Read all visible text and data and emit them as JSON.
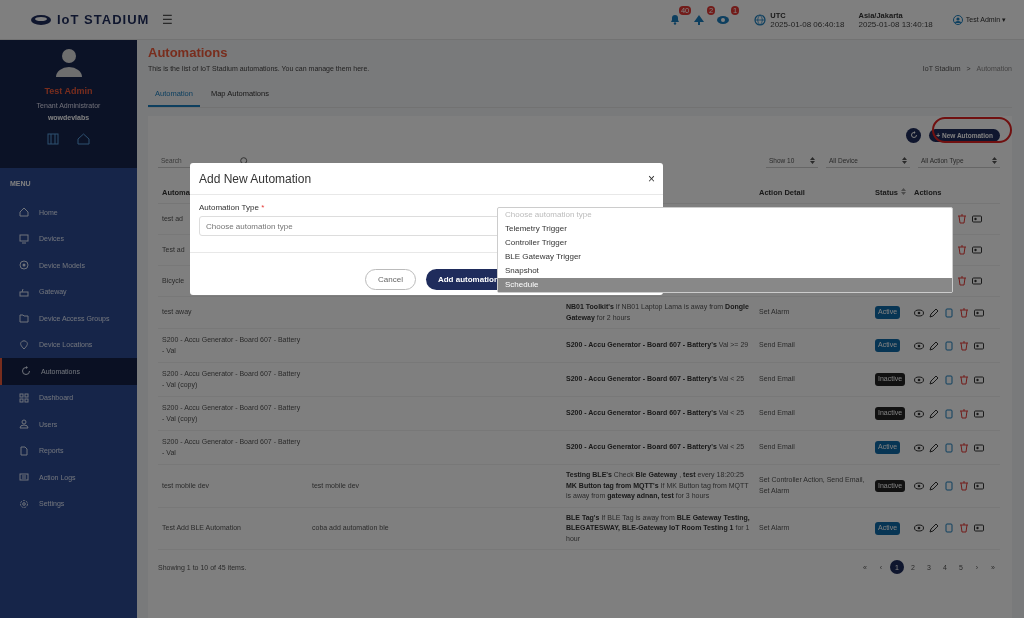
{
  "header": {
    "logo": "IoT STADIUM",
    "menu_glyph": "☰",
    "notifications": [
      {
        "count": "40"
      },
      {
        "count": "2"
      },
      {
        "count": "1"
      }
    ],
    "clocks": [
      {
        "zone": "UTC",
        "time": "2025-01-08 06:40:18"
      },
      {
        "zone": "Asia/Jakarta",
        "time": "2025-01-08 13:40:18"
      }
    ],
    "user": "Test Admin",
    "user_caret": "▾"
  },
  "sidebar": {
    "profile": {
      "name": "Test Admin",
      "role": "Tenant Administrator",
      "tenant": "wowdevlabs"
    },
    "menu_title": "MENU",
    "items": [
      {
        "label": "Home",
        "selected": false
      },
      {
        "label": "Devices",
        "selected": false
      },
      {
        "label": "Device Models",
        "selected": false
      },
      {
        "label": "Gateway",
        "selected": false
      },
      {
        "label": "Device Access Groups",
        "selected": false
      },
      {
        "label": "Device Locations",
        "selected": false
      },
      {
        "label": "Automations",
        "selected": true
      },
      {
        "label": "Dashboard",
        "selected": false
      },
      {
        "label": "Users",
        "selected": false
      },
      {
        "label": "Reports",
        "selected": false
      },
      {
        "label": "Action Logs",
        "selected": false
      },
      {
        "label": "Settings",
        "selected": false
      }
    ]
  },
  "page": {
    "title": "Automations",
    "description": "This is the list of IoT Stadium automations. You can manage them here.",
    "breadcrumb": [
      "IoT Stadium",
      "Automation"
    ],
    "breadcrumb_separator": ">",
    "tabs": [
      {
        "label": "Automation",
        "selected": true
      },
      {
        "label": "Map Automations",
        "selected": false
      }
    ]
  },
  "toolbar": {
    "new_button": "+ New Automation",
    "new_button_highlighted": true,
    "search_placeholder": "Search",
    "filters": [
      "Show 10",
      "All Device",
      "All Action Type"
    ]
  },
  "table": {
    "columns": [
      "Automa",
      "Action Detail",
      "Status",
      "Actions"
    ],
    "rows": [
      {
        "partial": true,
        "name": "test ad"
      },
      {
        "partial": true,
        "name": "Test ad"
      },
      {
        "partial": true,
        "name": "Bicycle"
      },
      {
        "partial": false,
        "name": "test away",
        "description": "",
        "trigger": "**NB01 Toolkit's** If NB01 Laptop Lama is away from **Dongle Gateway** for 2 hours",
        "action": "Set Alarm",
        "status": "Active",
        "active": true
      },
      {
        "partial": false,
        "name": "S200 - Accu Generator - Board 607 - Battery - Val",
        "description": "",
        "trigger": "**S200 - Accu Generator - Board 607 - Battery's** Val >= 29",
        "action": "Send Email",
        "status": "Active",
        "active": true
      },
      {
        "partial": false,
        "name": "S200 - Accu Generator - Board 607 - Battery - Val (copy)",
        "description": "",
        "trigger": "**S200 - Accu Generator - Board 607 - Battery's** Val < 25",
        "action": "Send Email",
        "status": "Inactive",
        "active": false
      },
      {
        "partial": false,
        "name": "S200 - Accu Generator - Board 607 - Battery - Val (copy)",
        "description": "",
        "trigger": "**S200 - Accu Generator - Board 607 - Battery's** Val < 25",
        "action": "Send Email",
        "status": "Inactive",
        "active": false
      },
      {
        "partial": false,
        "name": "S200 - Accu Generator - Board 607 - Battery - Val",
        "description": "",
        "trigger": "**S200 - Accu Generator - Board 607 - Battery's** Val < 25",
        "action": "Send Email",
        "status": "Active",
        "active": true
      },
      {
        "partial": false,
        "name": "test mobile dev",
        "description": "test mobile dev",
        "trigger": "**Testing BLE's** Check **Ble Gateway** , **test** every 18:20:25 **MK Button tag from MQTT's** If MK Button tag from MQTT is away from **gateway adnan, test** for 3 hours",
        "action": "Set Controller Action, Send Email, Set Alarm",
        "status": "Inactive",
        "active": false
      },
      {
        "partial": false,
        "name": "Test Add BLE Automation",
        "description": "coba add automation ble",
        "trigger": "**BLE Tag's** If BLE Tag is away from **BLE Gateway Testing, BLEGATESWAY, BLE-Gateway IoT Room Testing 1** for 1 hour",
        "action": "Set Alarm",
        "status": "Active",
        "active": true
      }
    ],
    "footer": "Showing 1 to 10 of 45 items.",
    "pagination": [
      {
        "label": "«",
        "selected": false
      },
      {
        "label": "‹",
        "selected": false
      },
      {
        "label": "1",
        "selected": true
      },
      {
        "label": "2",
        "selected": false
      },
      {
        "label": "3",
        "selected": false
      },
      {
        "label": "4",
        "selected": false
      },
      {
        "label": "5",
        "selected": false
      },
      {
        "label": "›",
        "selected": false
      },
      {
        "label": "»",
        "selected": false
      }
    ]
  },
  "modal": {
    "title": "Add New Automation",
    "close": "×",
    "field_label": "Automation Type",
    "required_mark": "*",
    "placeholder": "Choose automation type",
    "buttons": [
      {
        "label": "Cancel",
        "kind": "secondary"
      },
      {
        "label": "Add automation",
        "kind": "primary"
      }
    ],
    "dropdown": [
      {
        "label": "Choose automation type",
        "disabled": true,
        "selected": false
      },
      {
        "label": "Telemetry Trigger",
        "disabled": false,
        "selected": false
      },
      {
        "label": "Controller Trigger",
        "disabled": false,
        "selected": false
      },
      {
        "label": "BLE Gateway Trigger",
        "disabled": false,
        "selected": false
      },
      {
        "label": "Snapshot",
        "disabled": false,
        "selected": false
      },
      {
        "label": "Schedule",
        "disabled": false,
        "selected": true
      }
    ]
  }
}
